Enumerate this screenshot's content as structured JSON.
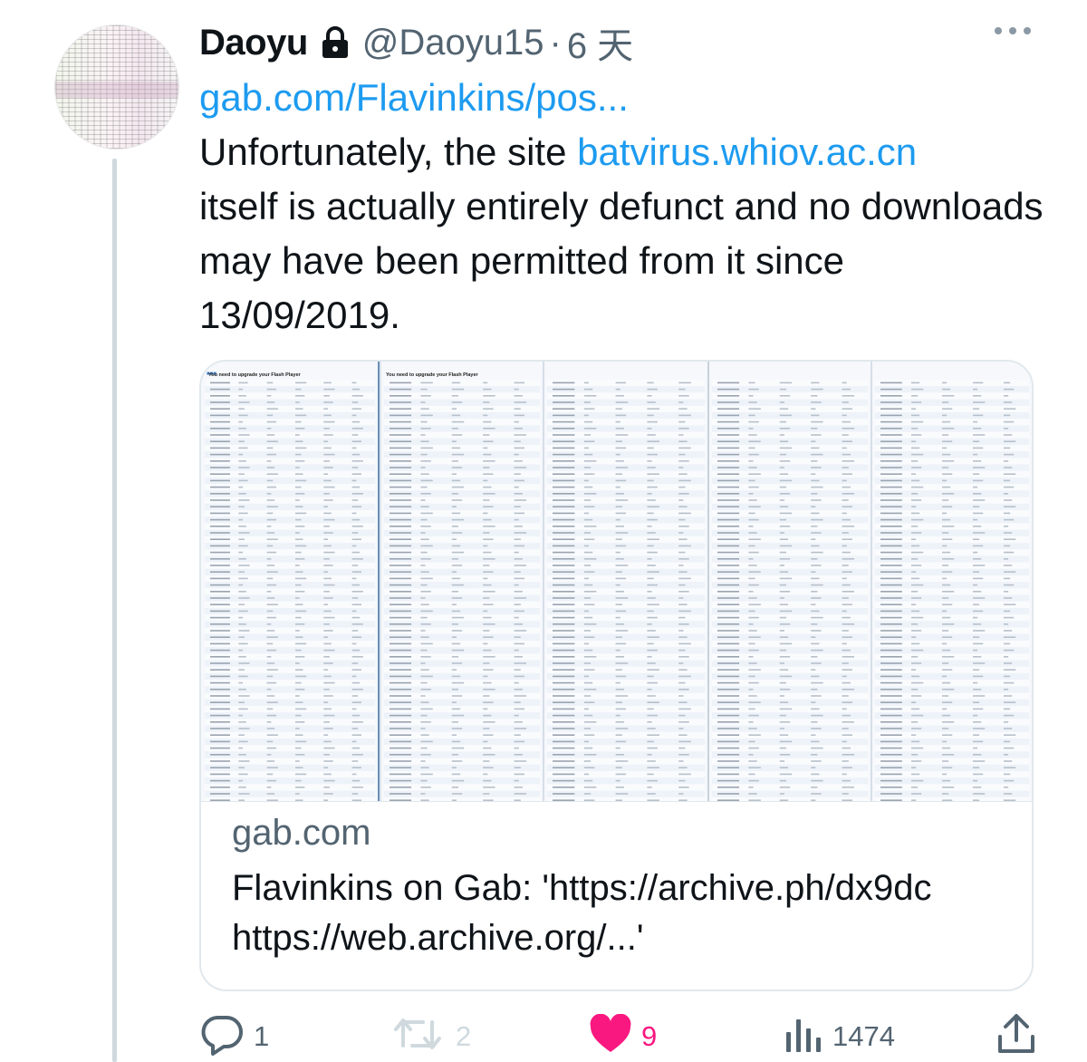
{
  "tweet": {
    "author_name": "Daoyu",
    "handle": "@Daoyu15",
    "separator": "·",
    "time": "6 天",
    "text_lines": {
      "link1": "gab.com/Flavinkins/pos...",
      "part1": "Unfortunately, the site ",
      "link2": "batvirus.whiov.ac.cn",
      "part2": "itself is actually entirely defunct and no downloads may have been permitted from it since 13/09/2019."
    }
  },
  "card": {
    "domain": "gab.com",
    "title": "Flavinkins on Gab: 'https://archive.ph/dx9dc https://web.archive.org/...'",
    "screenshot_panels": [
      {
        "banner": "You need to upgrade your Flash Player"
      },
      {
        "banner": "You need to upgrade your Flash Player"
      }
    ]
  },
  "actions": {
    "reply_count": "1",
    "retweet_count": "2",
    "like_count": "9",
    "view_count": "1474"
  },
  "colors": {
    "link": "#1d9bf0",
    "like": "#f91880",
    "secondary": "#536471",
    "disabled": "#cfd9de"
  },
  "icons": {
    "lock": "lock-icon",
    "more": "more-icon",
    "reply": "reply-icon",
    "retweet": "retweet-icon",
    "like": "heart-icon",
    "views": "views-icon",
    "share": "share-icon"
  }
}
